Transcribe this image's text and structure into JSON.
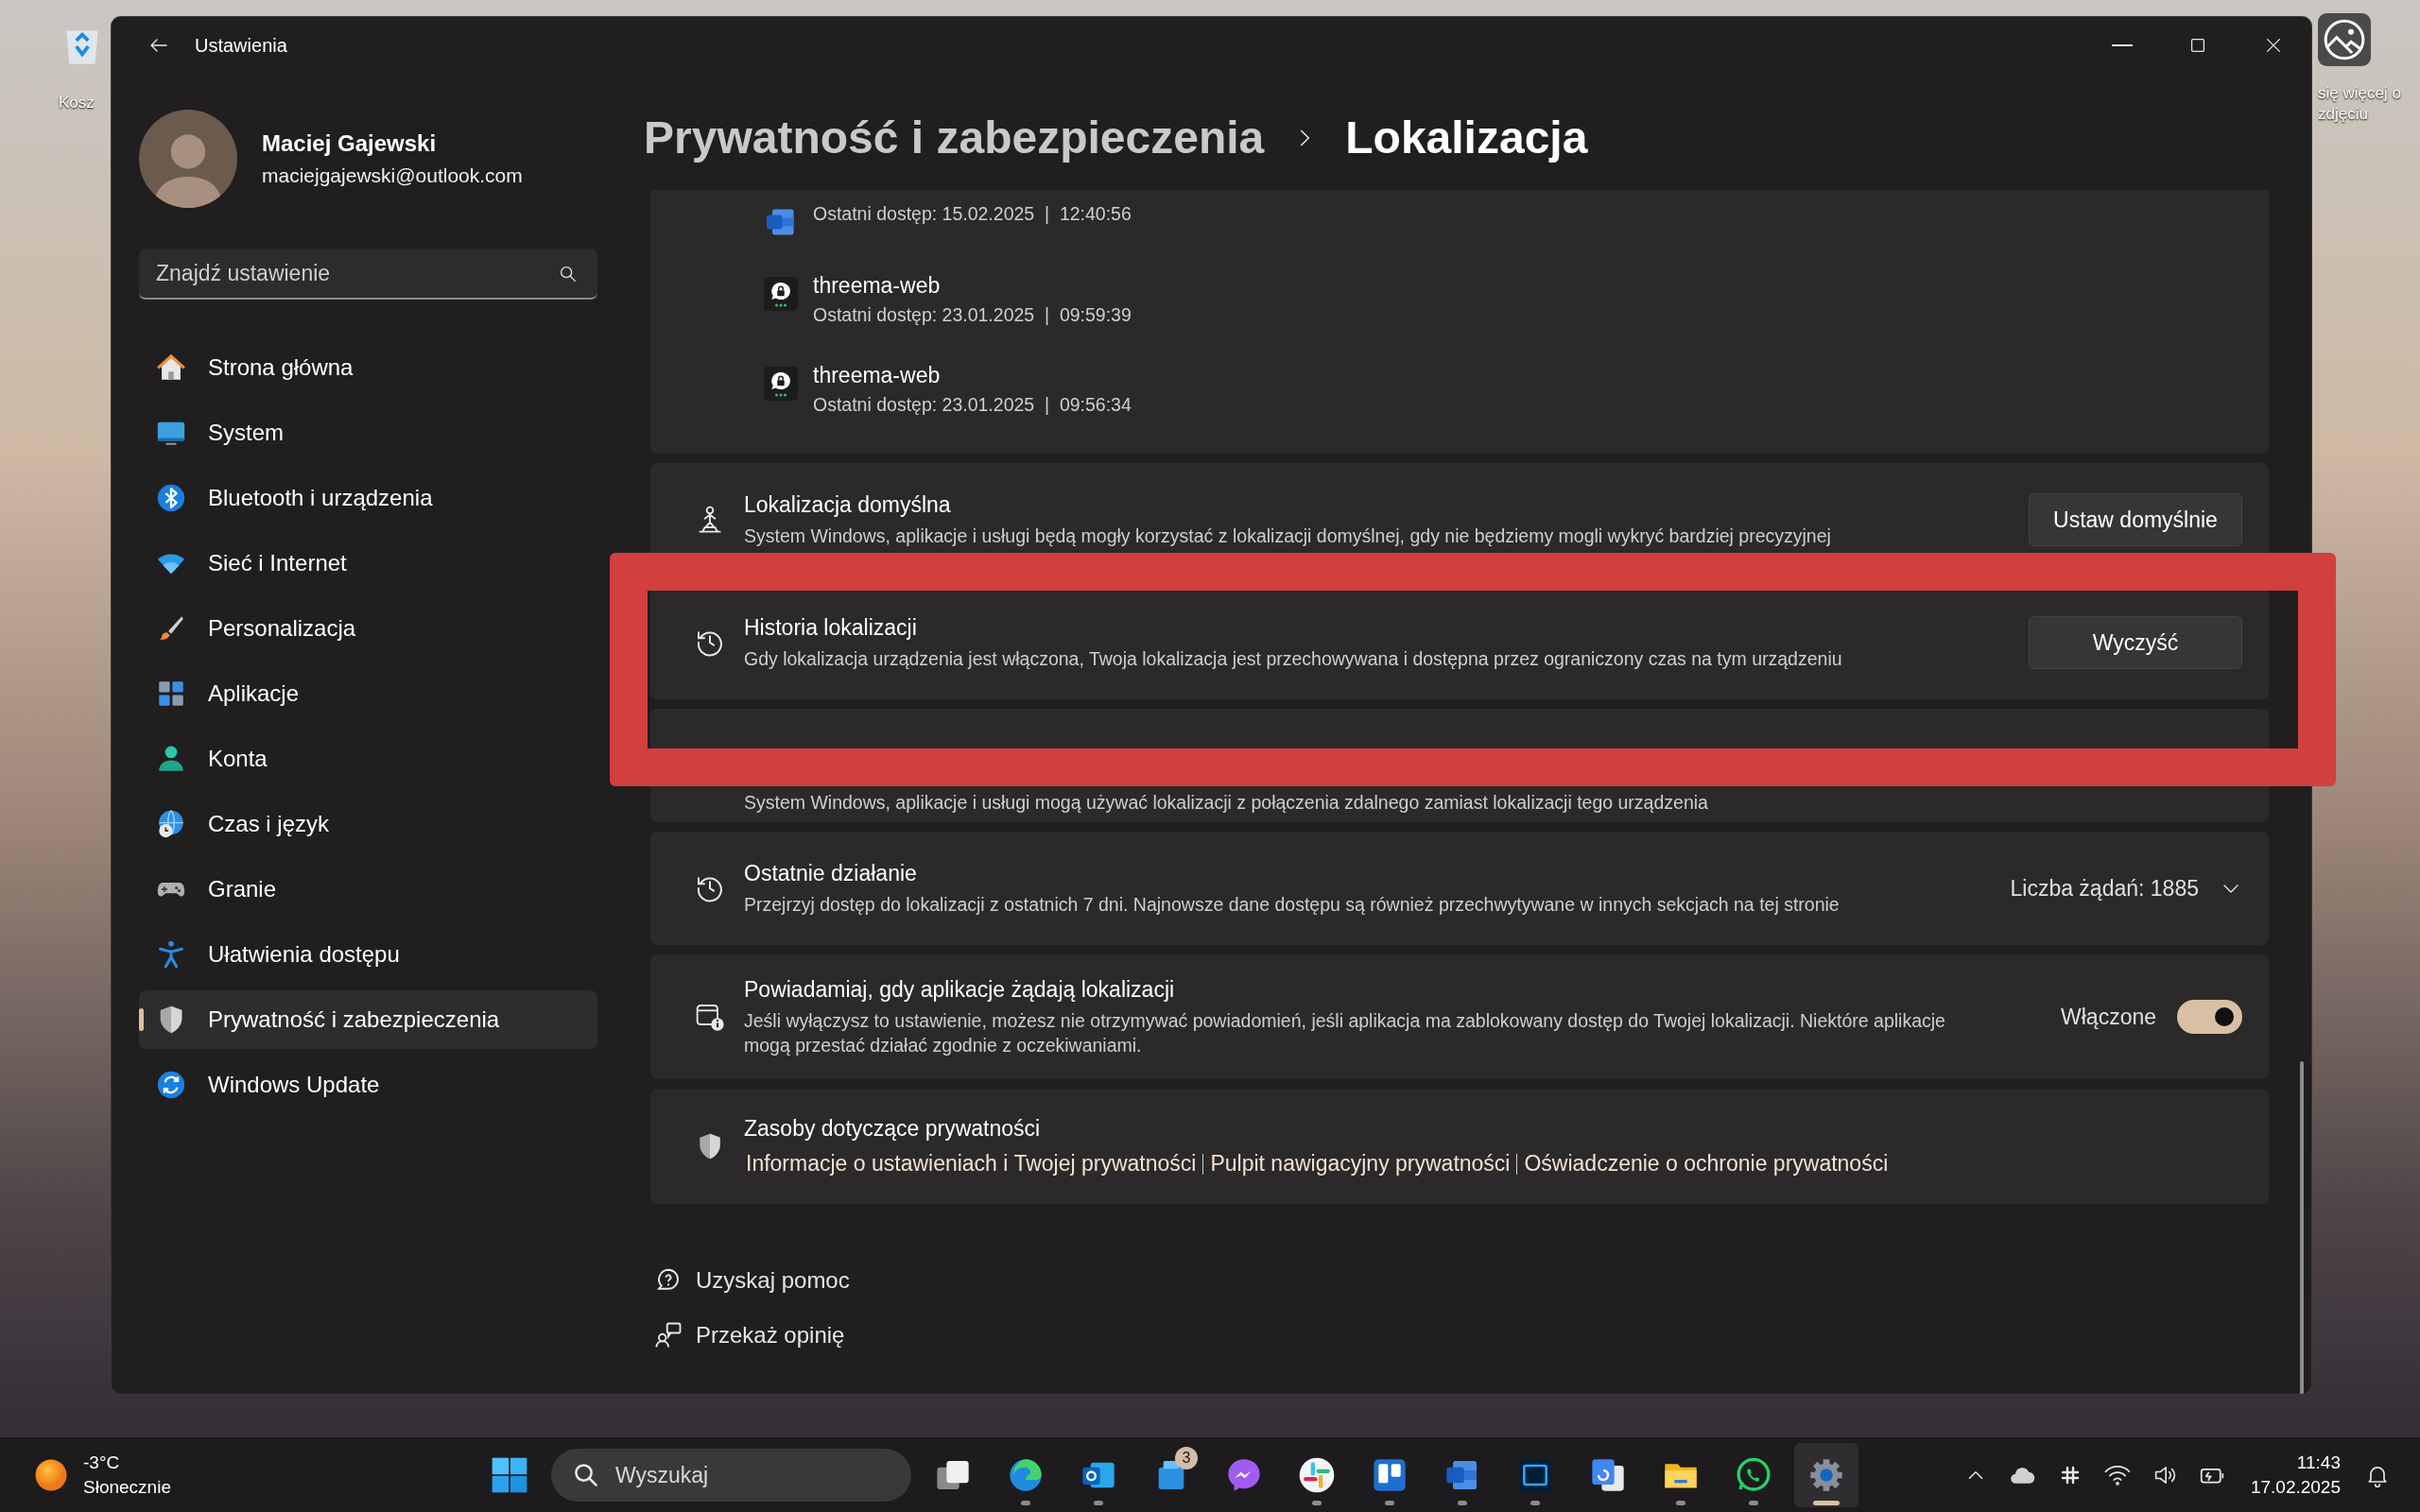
{
  "desktop": {
    "icons": [
      {
        "label": "Kosz"
      },
      {
        "label": "się więcej o zdjęciu"
      }
    ]
  },
  "window": {
    "title": "Ustawienia"
  },
  "user": {
    "name": "Maciej Gajewski",
    "email": "maciejgajewski@outlook.com"
  },
  "search": {
    "placeholder": "Znajdź ustawienie"
  },
  "nav": [
    {
      "label": "Strona główna",
      "selected": false
    },
    {
      "label": "System",
      "selected": false
    },
    {
      "label": "Bluetooth i urządzenia",
      "selected": false
    },
    {
      "label": "Sieć i Internet",
      "selected": false
    },
    {
      "label": "Personalizacja",
      "selected": false
    },
    {
      "label": "Aplikacje",
      "selected": false
    },
    {
      "label": "Konta",
      "selected": false
    },
    {
      "label": "Czas i język",
      "selected": false
    },
    {
      "label": "Granie",
      "selected": false
    },
    {
      "label": "Ułatwienia dostępu",
      "selected": false
    },
    {
      "label": "Prywatność i zabezpieczenia",
      "selected": true
    },
    {
      "label": "Windows Update",
      "selected": false
    }
  ],
  "breadcrumb": {
    "parent": "Prywatność i zabezpieczenia",
    "current": "Lokalizacja"
  },
  "recent_apps": [
    {
      "access": "Ostatni dostęp: 15.02.2025  |  12:40:56"
    },
    {
      "name": "threema-web",
      "access": "Ostatni dostęp: 23.01.2025  |  09:59:39"
    },
    {
      "name": "threema-web",
      "access": "Ostatni dostęp: 23.01.2025  |  09:56:34"
    }
  ],
  "cards": [
    {
      "kind": "button",
      "title": "Lokalizacja domyślna",
      "description": "System Windows, aplikacje i usługi będą mogły korzystać z lokalizacji domyślnej, gdy nie będziemy mogli wykryć bardziej precyzyjnej",
      "button": "Ustaw domyślnie"
    },
    {
      "kind": "button",
      "title": "Historia lokalizacji",
      "description": "Gdy lokalizacja urządzenia jest włączona, Twoja lokalizacja jest przechowywana i dostępna przez ograniczony czas na tym urządzeniu",
      "button": "Wyczyść"
    },
    {
      "kind": "covered",
      "description": "System Windows, aplikacje i usługi mogą używać lokalizacji z połączenia zdalnego zamiast lokalizacji tego urządzenia"
    },
    {
      "kind": "expander",
      "title": "Ostatnie działanie",
      "description": "Przejrzyj dostęp do lokalizacji z ostatnich 7 dni. Najnowsze dane dostępu są również przechwytywane w innych sekcjach na tej stronie",
      "value": "Liczba żądań: 1885",
      "expanded": false
    },
    {
      "kind": "toggle",
      "title": "Powiadamiaj, gdy aplikacje żądają lokalizacji",
      "description": "Jeśli wyłączysz to ustawienie, możesz nie otrzymywać powiadomień, jeśli aplikacja ma zablokowany dostęp do Twojej lokalizacji. Niektóre aplikacje mogą przestać działać zgodnie z oczekiwaniami.",
      "state_label": "Włączone",
      "on": true
    },
    {
      "kind": "links",
      "title": "Zasoby dotyczące prywatności",
      "links": [
        "Informacje o ustawieniach i Twojej prywatności",
        "Pulpit nawigacyjny prywatności",
        "Oświadczenie o ochronie prywatności"
      ]
    }
  ],
  "help_links": [
    {
      "label": "Uzyskaj pomoc"
    },
    {
      "label": "Przekaż opinię"
    }
  ],
  "taskbar": {
    "weather": {
      "temperature": "-3°C",
      "condition": "Słonecznie"
    },
    "search": {
      "placeholder": "Wyszukaj"
    },
    "apps": [
      {
        "running": false,
        "selected": false
      },
      {
        "running": true,
        "selected": false
      },
      {
        "running": true,
        "selected": false
      },
      {
        "running": false,
        "selected": false,
        "badge": "3"
      },
      {
        "running": false,
        "selected": false
      },
      {
        "running": true,
        "selected": false
      },
      {
        "running": true,
        "selected": false
      },
      {
        "running": true,
        "selected": false
      },
      {
        "running": true,
        "selected": false
      },
      {
        "running": false,
        "selected": false
      },
      {
        "running": true,
        "selected": false
      },
      {
        "running": true,
        "selected": false
      },
      {
        "running": true,
        "selected": true
      }
    ],
    "clock": {
      "time": "11:43",
      "date": "17.02.2025"
    }
  }
}
